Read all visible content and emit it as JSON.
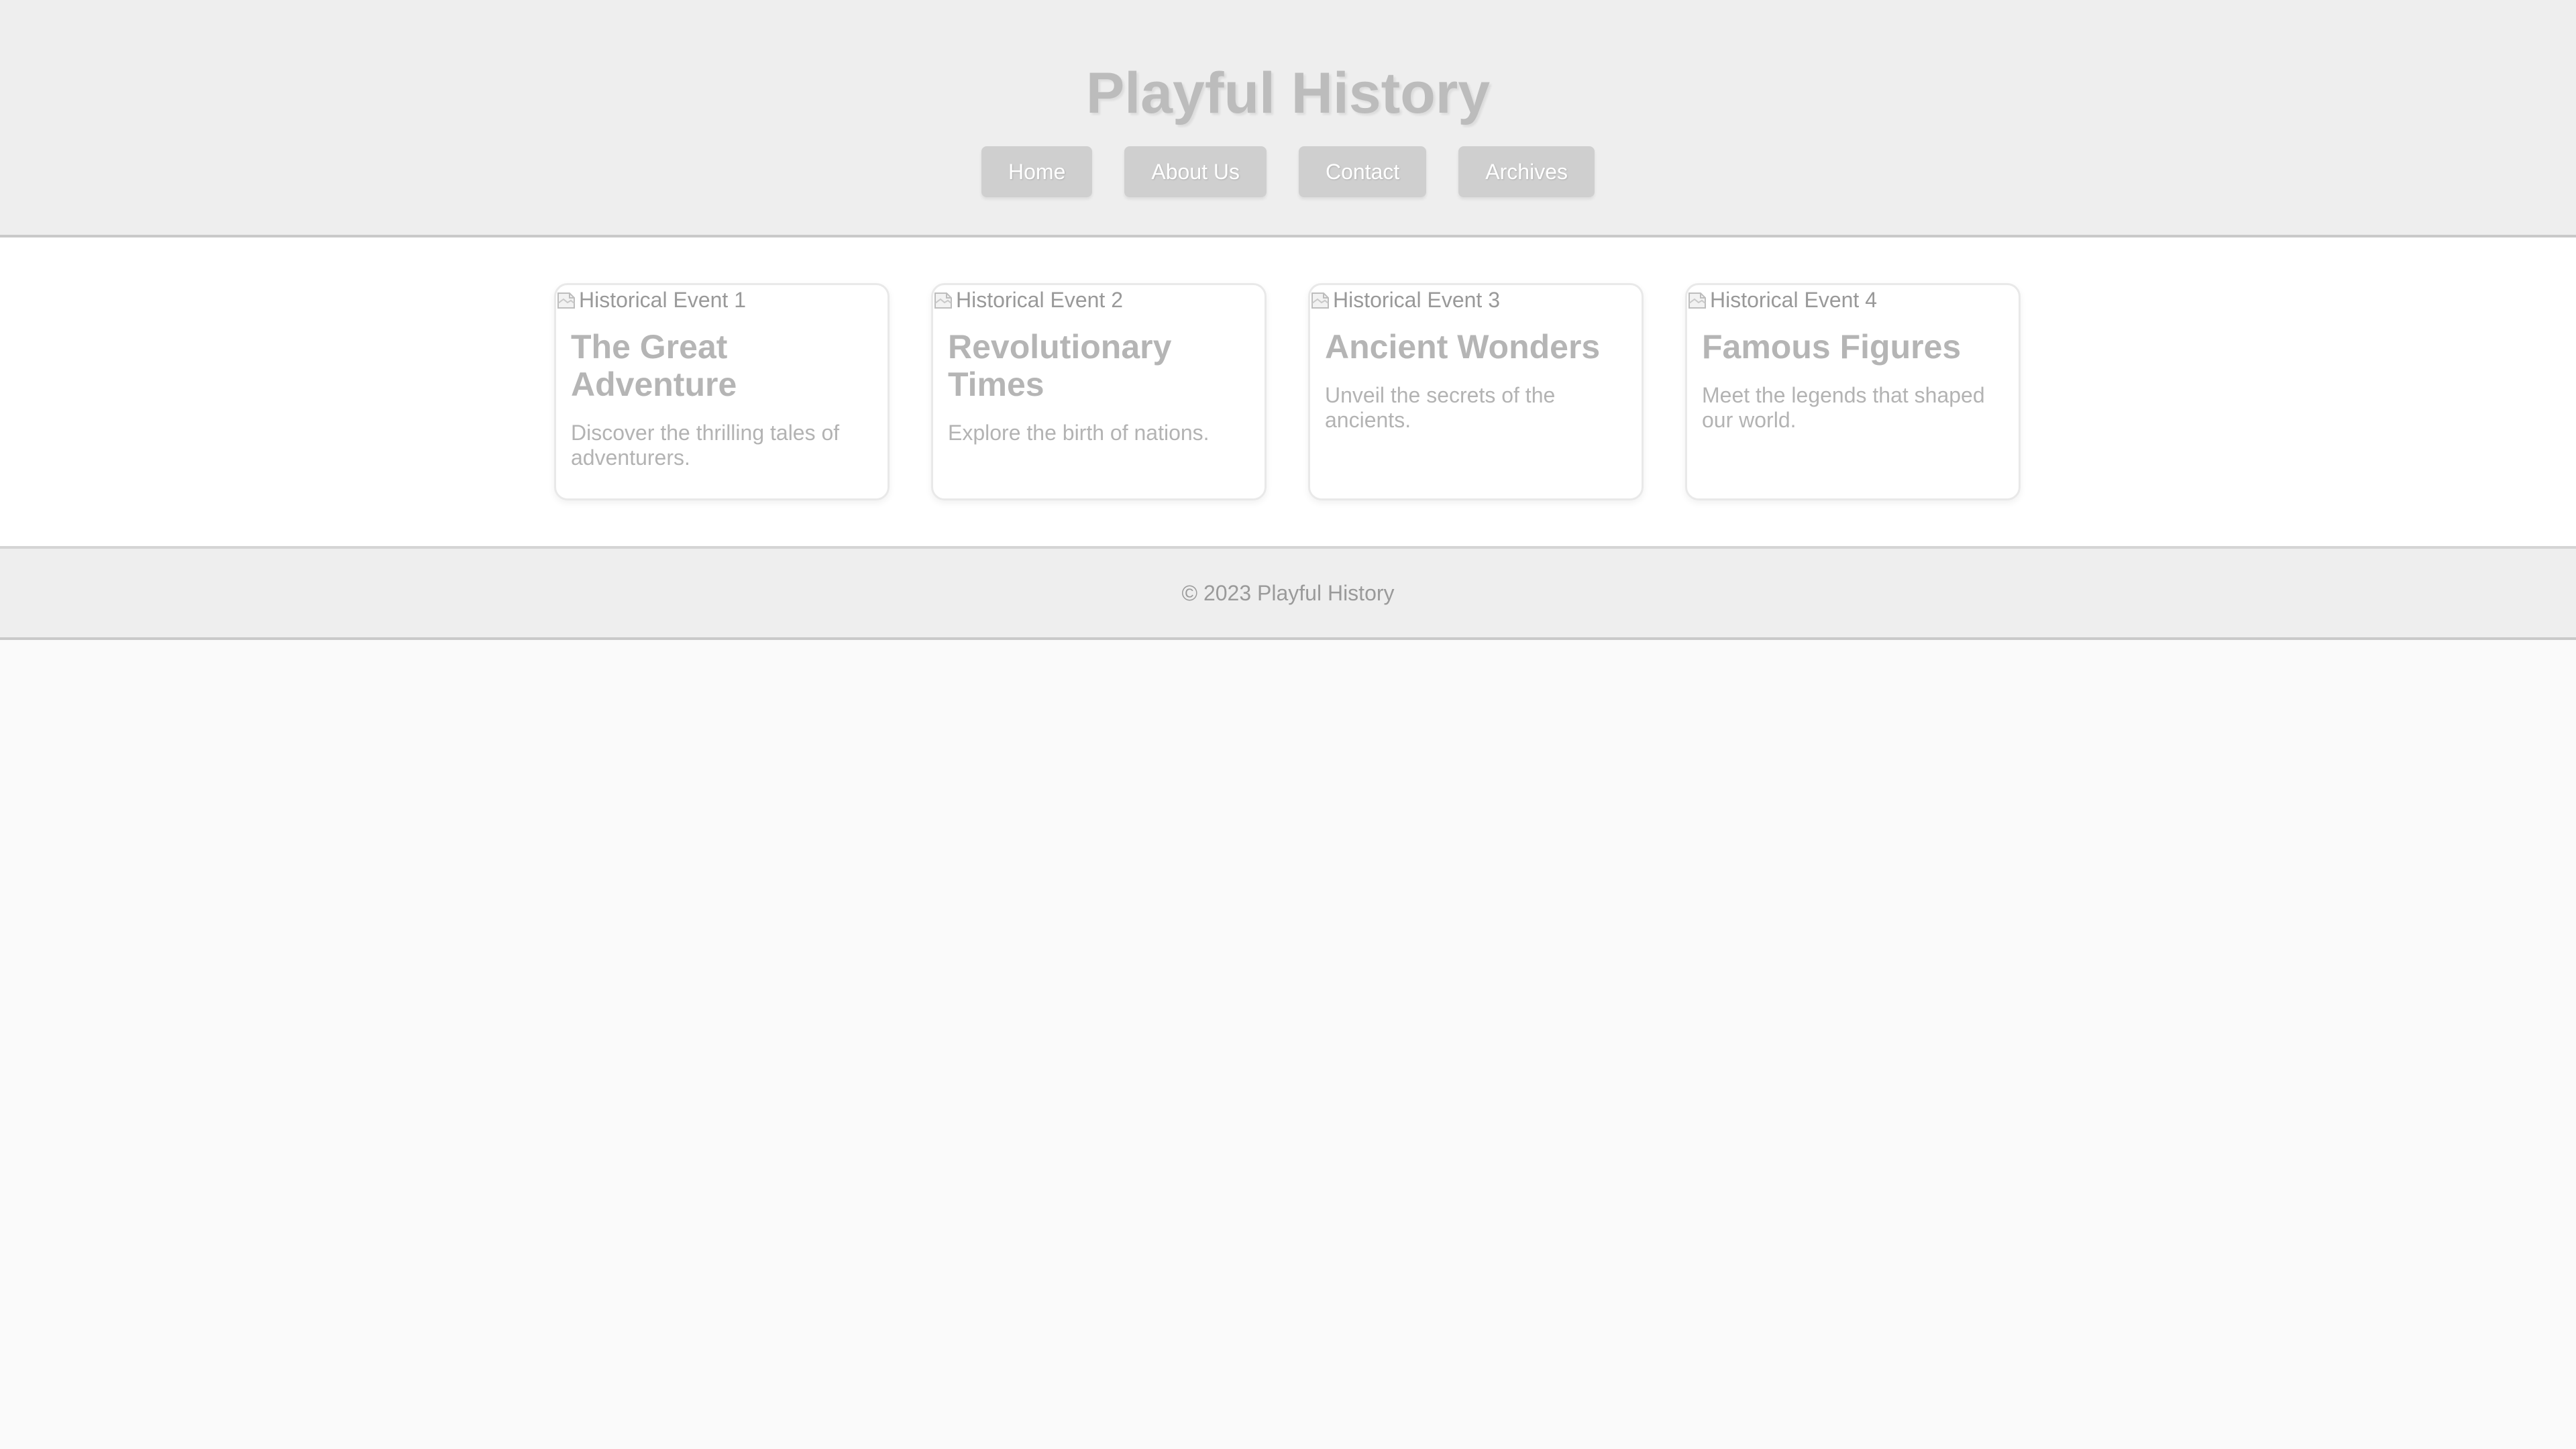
{
  "header": {
    "title": "Playful History"
  },
  "nav": {
    "items": [
      {
        "label": "Home"
      },
      {
        "label": "About Us"
      },
      {
        "label": "Contact"
      },
      {
        "label": "Archives"
      }
    ]
  },
  "cards": [
    {
      "image_alt": "Historical Event 1",
      "title": "The Great Adventure",
      "description": "Discover the thrilling tales of adventurers."
    },
    {
      "image_alt": "Historical Event 2",
      "title": "Revolutionary Times",
      "description": "Explore the birth of nations."
    },
    {
      "image_alt": "Historical Event 3",
      "title": "Ancient Wonders",
      "description": "Unveil the secrets of the ancients."
    },
    {
      "image_alt": "Historical Event 4",
      "title": "Famous Figures",
      "description": "Meet the legends that shaped our world."
    }
  ],
  "footer": {
    "text": "© 2023 Playful History"
  },
  "icons": {
    "broken_image": "broken-image-icon"
  },
  "colors": {
    "header_bg": "#eeeeee",
    "nav_button_bg": "#cfcfcf",
    "title_text": "#bcbcbc",
    "footer_bg": "#eeeeee"
  }
}
